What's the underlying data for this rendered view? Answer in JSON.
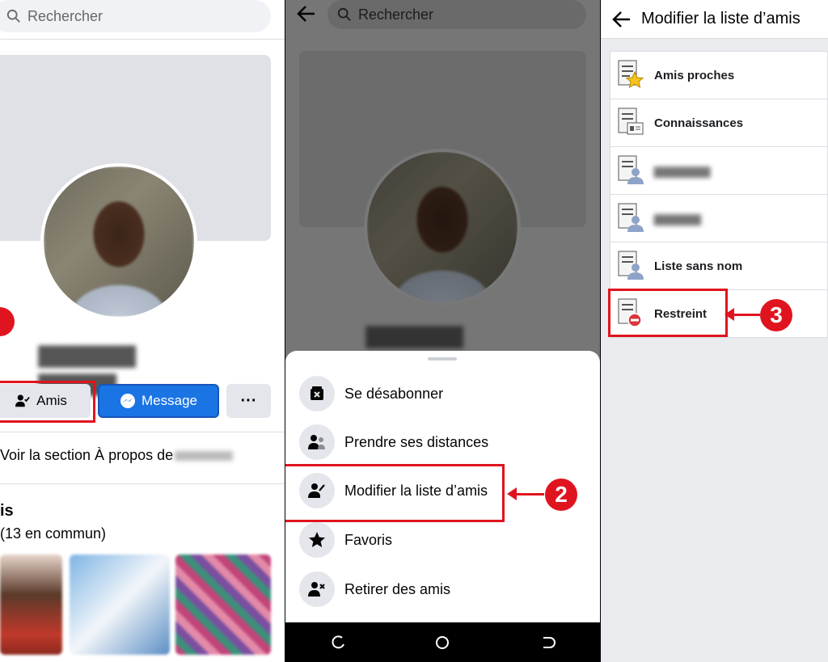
{
  "panel1": {
    "search_placeholder": "Rechercher",
    "btn_friends": "Amis",
    "btn_message": "Message",
    "btn_more": "···",
    "about_link": "Voir la section À propos de",
    "friends_title": "is",
    "friends_count": "(13 en commun)"
  },
  "panel2": {
    "search_placeholder": "Rechercher",
    "menu": [
      {
        "label": "Se désabonner",
        "icon": "unfollow-icon"
      },
      {
        "label": "Prendre ses distances",
        "icon": "take-break-icon"
      },
      {
        "label": "Modifier la liste d’amis",
        "icon": "edit-friend-list-icon"
      },
      {
        "label": "Favoris",
        "icon": "star-icon"
      },
      {
        "label": "Retirer des amis",
        "icon": "unfriend-icon"
      }
    ],
    "badge": "2"
  },
  "panel3": {
    "title": "Modifier la liste d’amis",
    "lists": [
      {
        "label": "Amis proches",
        "icon": "close-friends-icon"
      },
      {
        "label": "Connaissances",
        "icon": "acquaintances-icon"
      },
      {
        "label": "Liste sans nom",
        "icon": "unnamed-list-icon"
      },
      {
        "label": "Restreint",
        "icon": "restricted-icon"
      }
    ],
    "badge": "3"
  },
  "colors": {
    "accent_red": "#e0141e",
    "facebook_blue": "#1b74e4"
  }
}
